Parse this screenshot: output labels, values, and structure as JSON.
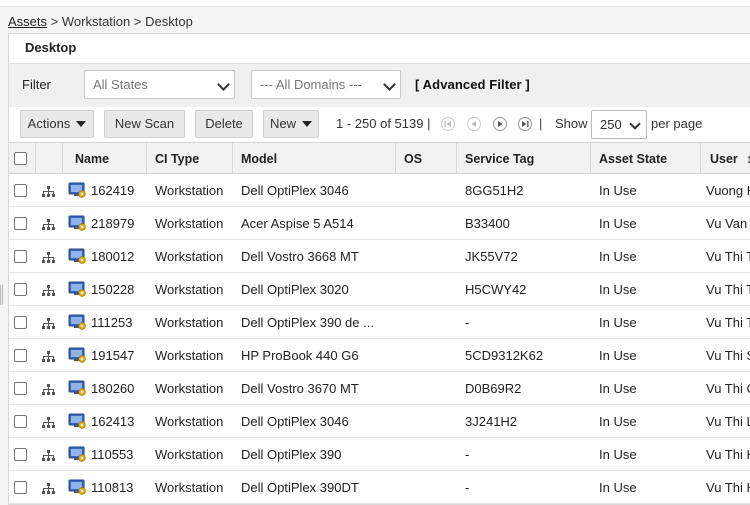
{
  "breadcrumb": {
    "root": "Assets",
    "mid": "Workstation",
    "current": "Desktop",
    "sep": ">"
  },
  "title": "Desktop",
  "filter": {
    "label": "Filter",
    "state_select": "All States",
    "domain_select": "--- All Domains ---",
    "advanced": "[ Advanced Filter ]"
  },
  "toolbar": {
    "actions": "Actions",
    "new_scan": "New Scan",
    "delete": "Delete",
    "new": "New",
    "range": "1 - 250 of 5139 |",
    "sep": "|",
    "show": "Show",
    "per_page_value": "250",
    "per_page": "per page"
  },
  "columns": {
    "name": "Name",
    "ci_type": "CI Type",
    "model": "Model",
    "os": "OS",
    "service_tag": "Service Tag",
    "asset_state": "Asset State",
    "user": "User"
  },
  "rows": [
    {
      "name": "162419",
      "ci_type": "Workstation",
      "model": "Dell OptiPlex 3046",
      "os": "",
      "service_tag": "8GG51H2",
      "asset_state": "In Use",
      "user": "Vuong H"
    },
    {
      "name": "218979",
      "ci_type": "Workstation",
      "model": "Acer Aspise 5 A514",
      "os": "",
      "service_tag": "B33400",
      "asset_state": "In Use",
      "user": "Vu Van N"
    },
    {
      "name": "180012",
      "ci_type": "Workstation",
      "model": "Dell Vostro 3668 MT",
      "os": "",
      "service_tag": "JK55V72",
      "asset_state": "In Use",
      "user": "Vu Thi T"
    },
    {
      "name": "150228",
      "ci_type": "Workstation",
      "model": "Dell OptiPlex 3020",
      "os": "",
      "service_tag": "H5CWY42",
      "asset_state": "In Use",
      "user": "Vu Thi T"
    },
    {
      "name": "111253",
      "ci_type": "Workstation",
      "model": "Dell OptiPlex 390 de ...",
      "os": "",
      "service_tag": "-",
      "asset_state": "In Use",
      "user": "Vu Thi T"
    },
    {
      "name": "191547",
      "ci_type": "Workstation",
      "model": "HP ProBook 440 G6",
      "os": "",
      "service_tag": "5CD9312K62",
      "asset_state": "In Use",
      "user": "Vu Thi S"
    },
    {
      "name": "180260",
      "ci_type": "Workstation",
      "model": "Dell Vostro 3670 MT",
      "os": "",
      "service_tag": "D0B69R2",
      "asset_state": "In Use",
      "user": "Vu Thi C"
    },
    {
      "name": "162413",
      "ci_type": "Workstation",
      "model": "Dell OptiPlex 3046",
      "os": "",
      "service_tag": "3J241H2",
      "asset_state": "In Use",
      "user": "Vu Thi L"
    },
    {
      "name": "110553",
      "ci_type": "Workstation",
      "model": "Dell OptiPlex 390",
      "os": "",
      "service_tag": "-",
      "asset_state": "In Use",
      "user": "Vu Thi K"
    },
    {
      "name": "110813",
      "ci_type": "Workstation",
      "model": "Dell OptiPlex 390DT",
      "os": "",
      "service_tag": "-",
      "asset_state": "In Use",
      "user": "Vu Thi K"
    }
  ],
  "icons": {
    "network": "network-topology-icon",
    "workstation": "workstation-icon"
  }
}
